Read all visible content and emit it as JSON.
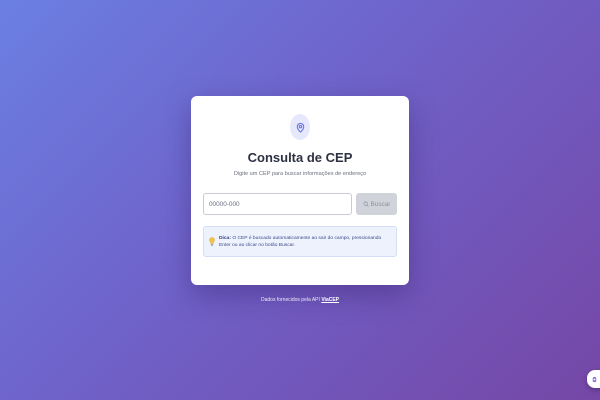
{
  "card": {
    "title": "Consulta de CEP",
    "subtitle": "Digite um CEP para buscar informações de endereço"
  },
  "form": {
    "cep_placeholder": "00000-000",
    "search_label": "Buscar"
  },
  "tip": {
    "label": "Dica:",
    "text": "O CEP é buscado automaticamente ao sair do campo, pressionando Enter ou ao clicar no botão Buscar."
  },
  "footer": {
    "prefix": "Dados fornecidos pela API",
    "link_label": "ViaCEP"
  },
  "icons": {
    "header": "map-pin-icon",
    "search": "search-icon",
    "tip": "lightbulb-icon",
    "floating": "app-widget-icon"
  },
  "colors": {
    "accent": "#6c74e0",
    "title": "#2d3142",
    "button_disabled": "#d1d3da",
    "tip_background": "#eef2fd",
    "tip_text": "#3b4a8c"
  }
}
